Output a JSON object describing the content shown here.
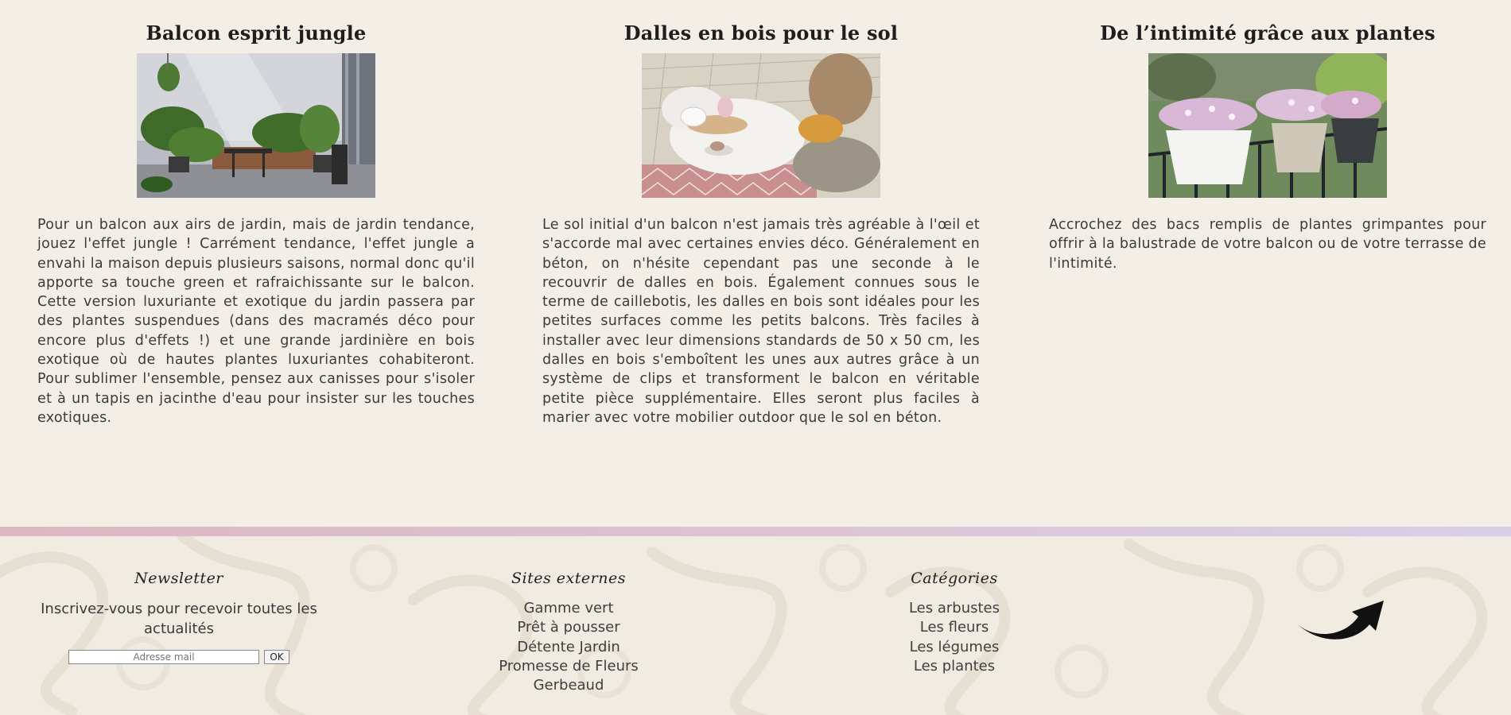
{
  "articles": [
    {
      "title": "Balcon esprit jungle",
      "image_alt": "balcon-jungle-photo",
      "text": "Pour un balcon aux airs de jardin, mais de jardin tendance, jouez l'effet jungle ! Carrément tendance, l'effet jungle a envahi la maison depuis plusieurs saisons, normal donc qu'il apporte sa touche green et rafraichissante sur le balcon. Cette version luxuriante et exotique du jardin passera par des plantes suspendues (dans des macramés déco pour encore plus d'effets !) et une grande jardinière en bois exotique où de hautes plantes luxuriantes cohabiteront. Pour sublimer l'ensemble, pensez aux canisses pour s'isoler et à un tapis en jacinthe d'eau pour insister sur les touches exotiques."
    },
    {
      "title": "Dalles en bois pour le sol",
      "image_alt": "dalles-bois-photo",
      "text": "Le sol initial d'un balcon n'est jamais très agréable à l'œil et s'accorde mal avec certaines envies déco. Généralement en béton, on n'hésite cependant pas une seconde à le recouvrir de dalles en bois. Également connues sous le terme de caillebotis, les dalles en bois sont idéales pour les petites surfaces comme les petits balcons. Très faciles à installer avec leur dimensions standards de 50 x 50 cm, les dalles en bois s'emboîtent les unes aux autres grâce à un système de clips et transforment le balcon en véritable petite pièce supplémentaire. Elles seront plus faciles à marier avec votre mobilier outdoor que le sol en béton."
    },
    {
      "title": "De l’intimité grâce aux plantes",
      "image_alt": "bacs-plantes-photo",
      "text": "Accrochez des bacs remplis de plantes grimpantes pour offrir à la balustrade de votre balcon ou de votre terrasse de l'intimité."
    }
  ],
  "footer": {
    "newsletter": {
      "heading": "Newsletter",
      "lead": "Inscrivez-vous pour recevoir toutes les actualités",
      "placeholder": "Adresse mail",
      "ok_label": "OK"
    },
    "sites": {
      "heading": "Sites externes",
      "links": [
        "Gamme vert",
        "Prêt à pousser",
        "Détente Jardin",
        "Promesse de Fleurs",
        "Gerbeaud"
      ]
    },
    "categories": {
      "heading": "Catégories",
      "links": [
        "Les arbustes",
        "Les fleurs",
        "Les légumes",
        "Les plantes"
      ]
    },
    "back_to_top_icon": "curved-up-arrow-icon"
  },
  "colors": {
    "page_bg": "#f3efe5",
    "divider_start": "#dcb8c2",
    "divider_end": "#d7cfe8",
    "heading": "#1e1e1e",
    "body_text": "#3b3b3b"
  }
}
